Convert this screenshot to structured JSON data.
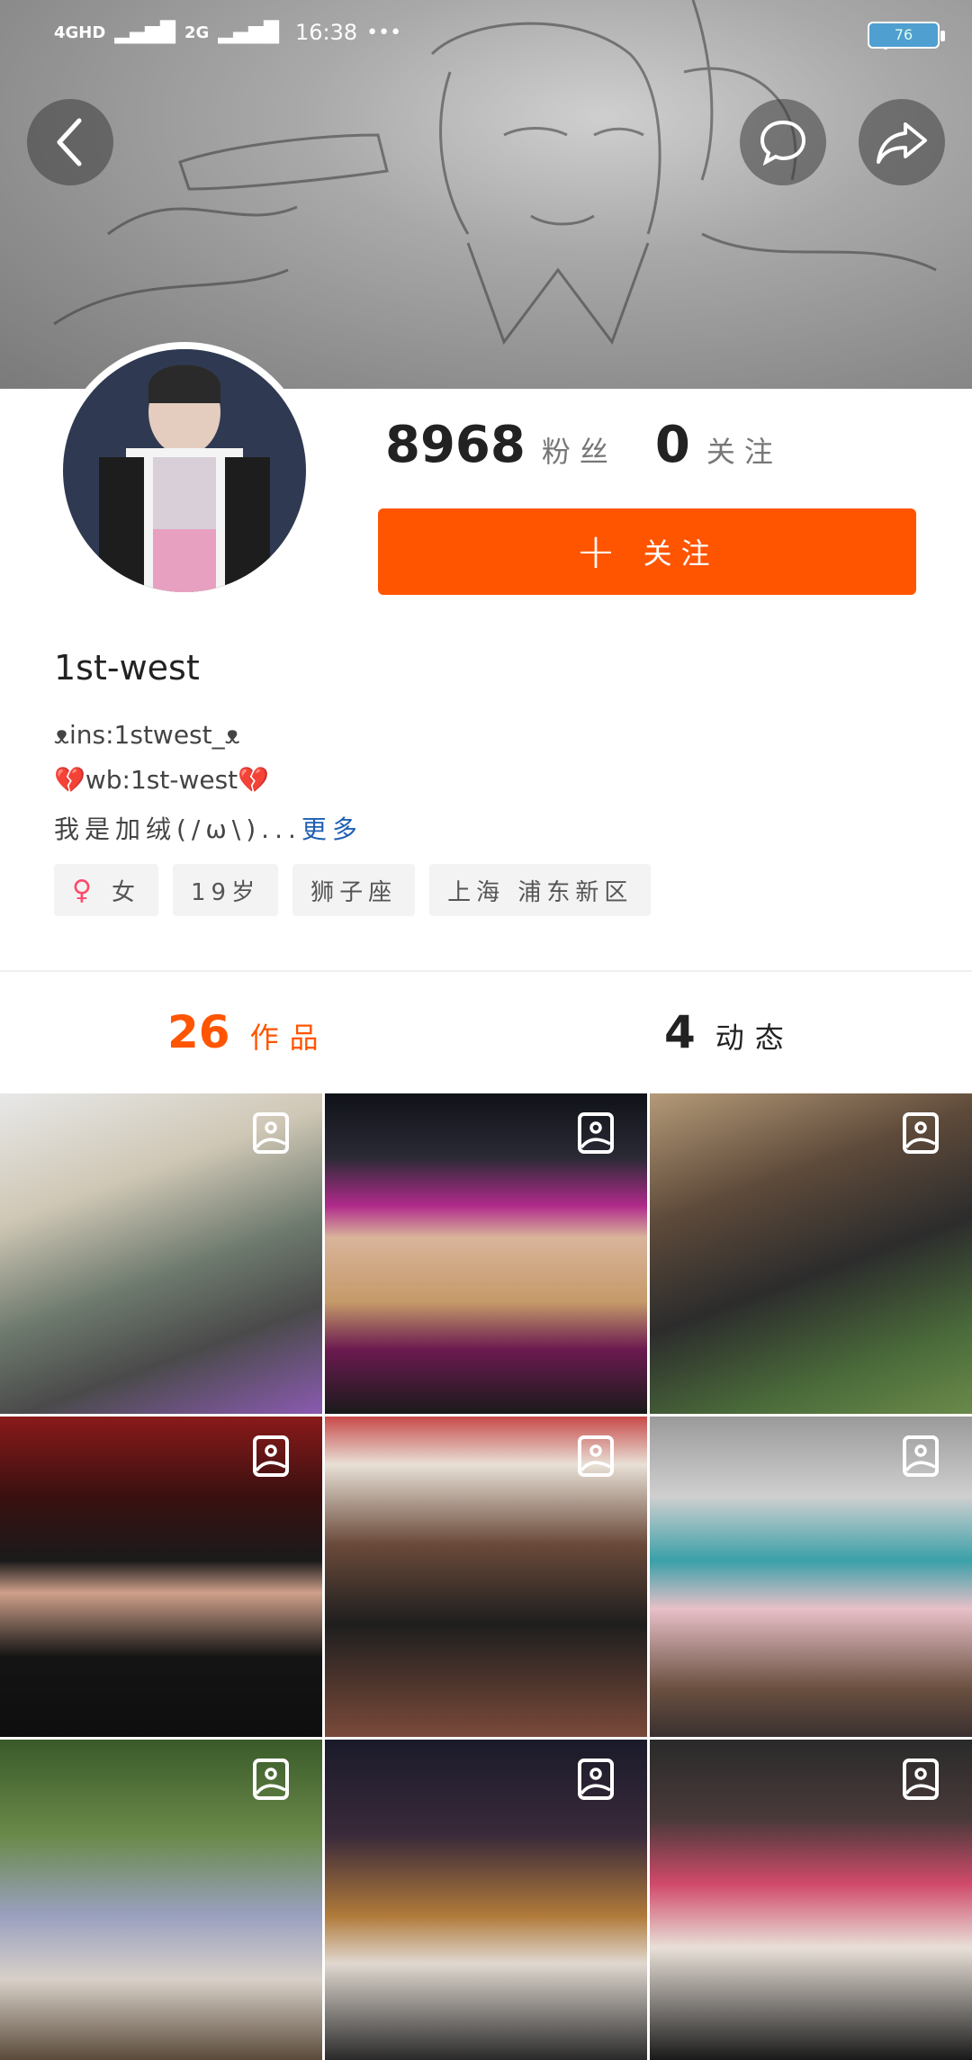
{
  "status_bar": {
    "network1": "4GHD",
    "network2": "2G",
    "time": "16:38",
    "more": "•••",
    "battery": "76"
  },
  "header_buttons": {
    "back": "back-icon",
    "comment": "comment-icon",
    "share": "share-icon"
  },
  "profile": {
    "followers_count": "8968",
    "followers_label": "粉丝",
    "following_count": "0",
    "following_label": "关注",
    "follow_button_label": "关注",
    "username": "1st-west",
    "bio_line1": "ᴥins:1stwest_ᴥ",
    "bio_line2": "💔wb:1st-west💔",
    "bio_line3": "我是加绒(/ω\\)...",
    "bio_more": "更多",
    "tags": {
      "gender": "女",
      "gender_icon": "♀",
      "age": "19岁",
      "zodiac": "狮子座",
      "location": "上海 浦东新区"
    }
  },
  "tabs": {
    "works_count": "26",
    "works_label": "作品",
    "moments_count": "4",
    "moments_label": "动态"
  },
  "colors": {
    "accent": "#ff5500",
    "link": "#1e5fb3"
  },
  "grid_items": [
    {
      "type": "image-post",
      "bg": "linear-gradient(160deg,#e8e8e8 0%,#cfc7b5 30%,#6e7a6e 55%,#4a4a4a 75%,#8a5ab0 100%)"
    },
    {
      "type": "image-post",
      "bg": "linear-gradient(180deg,#101218 0%,#2a2a35 20%,#b02a8a 35%,#d9b49a 45%,#c59a6a 65%,#6b1a50 80%,#1a1a1a 100%)"
    },
    {
      "type": "image-post",
      "bg": "linear-gradient(160deg,#b49a78 0%,#5e4a3a 30%,#2c2c2c 55%,#4a6a3a 80%,#6a8a4a 100%)"
    },
    {
      "type": "image-post",
      "bg": "linear-gradient(180deg,#8a1a1a 0%,#3a1010 25%,#1a1a1a 45%,#cfa08a 55%,#141414 75%,#0e0e0e 100%)"
    },
    {
      "type": "image-post",
      "bg": "linear-gradient(180deg,#c84a4a 0%,#e8e0d6 15%,#6a4a3a 40%,#1e1e1e 65%,#7a4a3a 100%)"
    },
    {
      "type": "image-post",
      "bg": "linear-gradient(180deg,#9a9a9a 0%,#cfcfcf 25%,#3aa0a8 45%,#e8c0c8 60%,#6a5040 85%,#3a3030 100%)"
    },
    {
      "type": "image-post",
      "bg": "linear-gradient(180deg,#3a5a2a 0%,#6a8a4a 30%,#9aa0c0 55%,#d8d0c8 75%,#5a4a3a 100%)"
    },
    {
      "type": "image-post",
      "bg": "linear-gradient(180deg,#1a1a2a 0%,#3a2a3a 30%,#b07a3a 55%,#e0d8d0 70%,#2a2a2a 100%)"
    },
    {
      "type": "image-post",
      "bg": "linear-gradient(180deg,#2a2a2a 0%,#4a3a3a 25%,#d04a6a 45%,#e8e0d8 65%,#1a1a1a 100%)"
    }
  ]
}
